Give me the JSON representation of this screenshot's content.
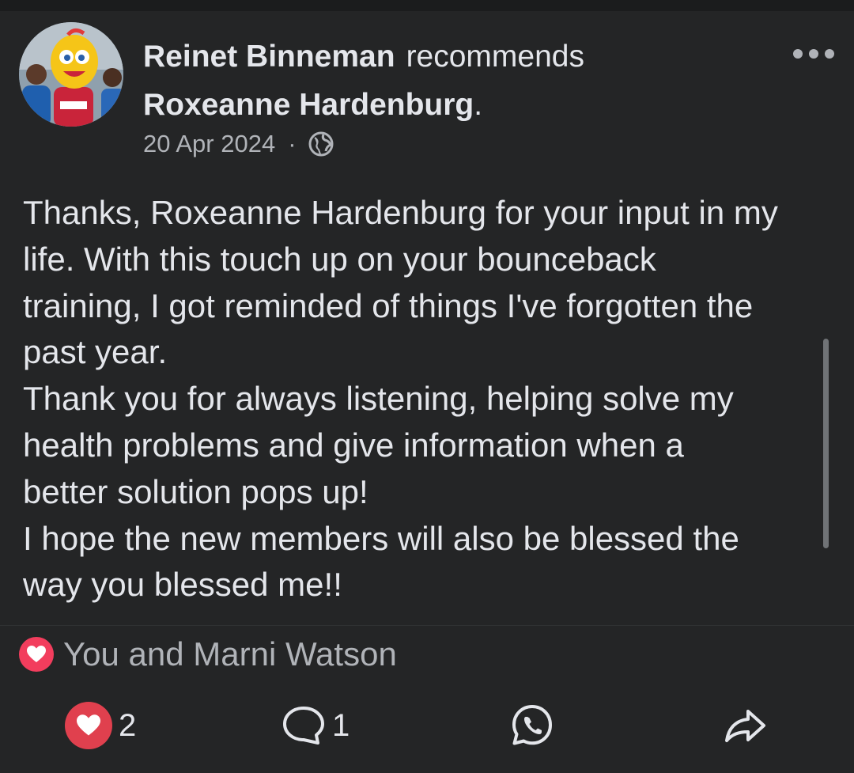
{
  "post": {
    "author": "Reinet Binneman",
    "action_verb": "recommends",
    "recommended_name": "Roxeanne Hardenburg",
    "recommended_suffix": ".",
    "date": "20 Apr 2024",
    "separator": "·",
    "audience_icon": "globe-icon",
    "more_icon": "more-dots-icon",
    "body_lines": [
      "Thanks, Roxeanne Hardenburg for your input in my",
      "life. With this touch up on your bounceback",
      "training, I got reminded of things I've forgotten the",
      "past year.",
      "Thank you for always listening, helping solve my",
      "health problems and give information when a",
      "better solution pops up!",
      "I hope the new members will also be blessed the",
      "way you blessed me!!"
    ]
  },
  "reactions": {
    "icon": "heart-icon",
    "summary": "You and Marni Watson"
  },
  "actions": {
    "like_count": "2",
    "comment_count": "1",
    "like_icon": "heart-icon",
    "comment_icon": "comment-bubble-icon",
    "whatsapp_icon": "whatsapp-icon",
    "share_icon": "share-arrow-icon"
  },
  "colors": {
    "background": "#242526",
    "primary_text": "#e4e6eb",
    "secondary_text": "#b0b3b8",
    "love_red": "#f23d5d"
  }
}
